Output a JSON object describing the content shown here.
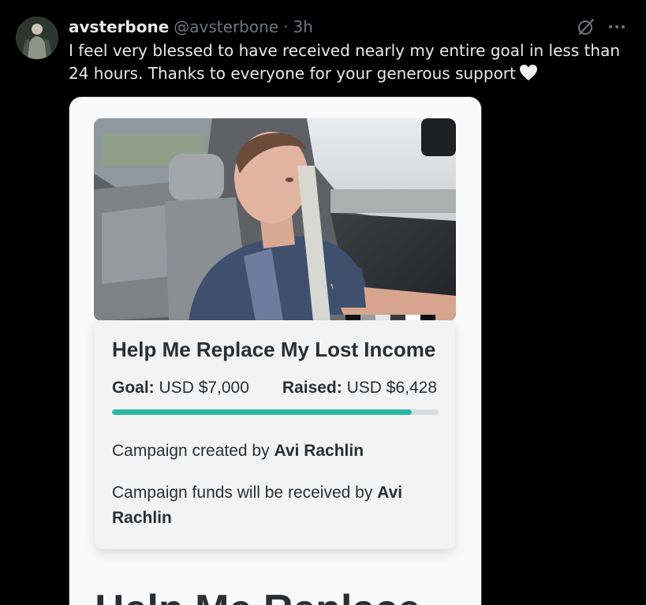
{
  "post": {
    "display_name": "avsterbone",
    "handle": "@avsterbone",
    "separator": "·",
    "time": "3h",
    "text": "I feel very blessed to have received nearly my entire goal in less than 24 hours. Thanks to everyone for your generous support",
    "emoji": "white-heart-emoji"
  },
  "icons": {
    "grok": "grok-icon",
    "more": "more-icon"
  },
  "campaign": {
    "title": "Help Me Replace My Lost Income",
    "goal_label": "Goal:",
    "goal_value": "USD $7,000",
    "raised_label": "Raised:",
    "raised_value": "USD $6,428",
    "progress_fraction": 0.918,
    "created_prefix": "Campaign created by",
    "created_by": "Avi Rachlin",
    "funds_prefix": "Campaign funds will be received by",
    "funds_to": "Avi Rachlin",
    "next_heading": "Help Me Replace"
  },
  "colors": {
    "background": "#000000",
    "progress": "#2bb8a3",
    "muted_text": "#71767b"
  }
}
